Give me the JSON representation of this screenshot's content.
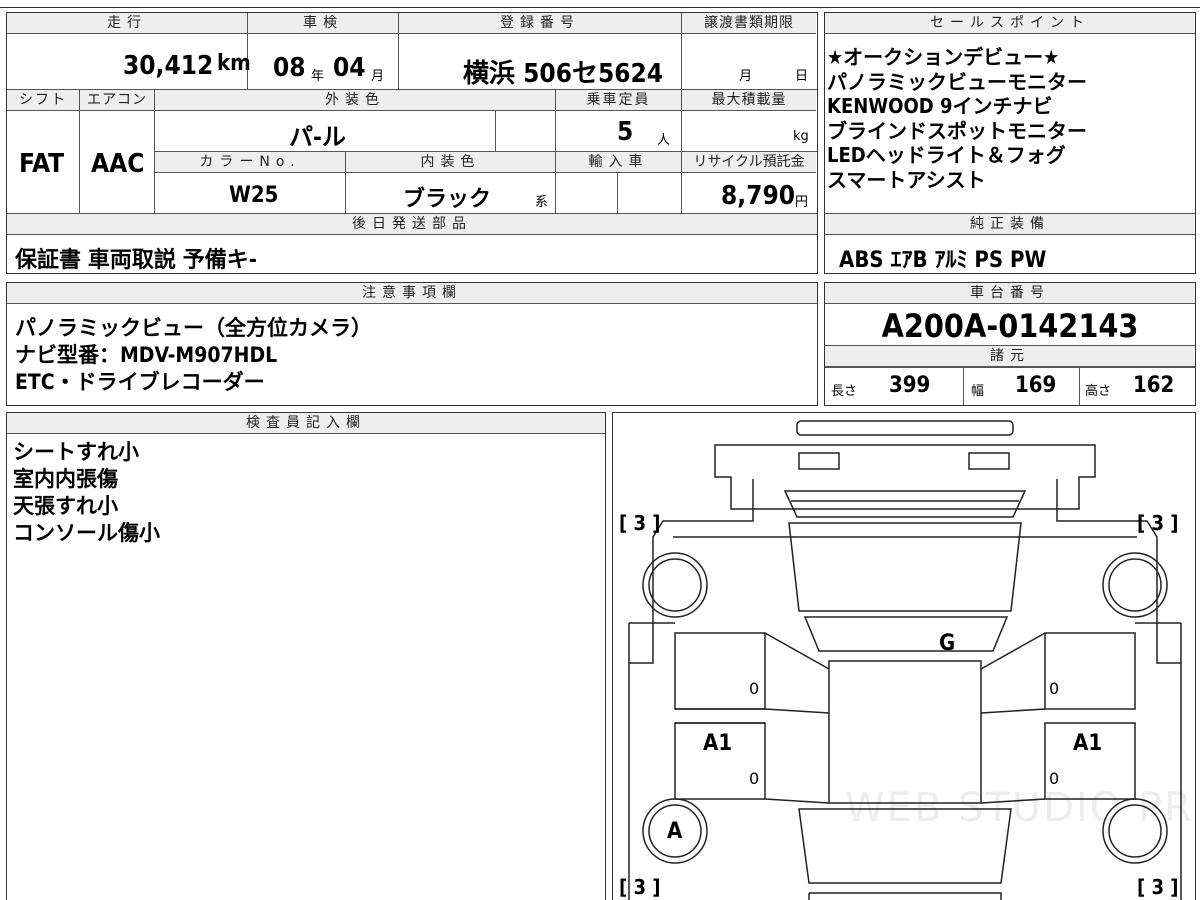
{
  "top_strip": {
    "partial": "…"
  },
  "header_labels": {
    "mileage": "走行",
    "inspection": "車検",
    "registration": "登録番号",
    "transfer_deadline": "譲渡書類期限",
    "shift": "シフト",
    "aircon": "エアコン",
    "exterior_color": "外装色",
    "capacity": "乗車定員",
    "max_load": "最大積載量",
    "color_no": "カラーNo.",
    "interior_color": "内装色",
    "import": "輸入車",
    "recycle": "リサイクル預託金",
    "later_parts": "後日発送部品",
    "sales_points": "セールスポイント",
    "genuine_equipment": "純正装備",
    "notes": "注意事項欄",
    "chassis_no": "車台番号",
    "specs": "諸元",
    "inspector": "検査員記入欄"
  },
  "vehicle": {
    "mileage_value": "30,412",
    "mileage_unit": "km",
    "inspection_year": "08",
    "inspection_year_unit": "年",
    "inspection_month": "04",
    "inspection_month_unit": "月",
    "registration": "横浜 506セ5624",
    "transfer_month": "月",
    "transfer_day": "日",
    "shift": "FAT",
    "aircon": "AAC",
    "exterior_color": "パ-ル",
    "capacity": "5",
    "capacity_unit": "人",
    "max_load_unit": "kg",
    "color_no": "W25",
    "interior_color": "ブラック",
    "interior_suffix": "系",
    "recycle_value": "8,790",
    "recycle_unit": "円",
    "later_parts": "保証書 車両取説 予備キ-",
    "chassis_no": "A200A-0142143"
  },
  "sales_points": [
    "★オークションデビュー★",
    "パノラミックビューモニター",
    "KENWOOD 9インチナビ",
    "ブラインドスポットモニター",
    "LEDヘッドライト＆フォグ",
    "スマートアシスト"
  ],
  "genuine_equipment": "ABS ｴｱB ｱﾙﾐ PS PW",
  "notes": [
    "パノラミックビュー（全方位カメラ）",
    "ナビ型番：MDV-M907HDL",
    "ETC・ドライブレコーダー"
  ],
  "specs": {
    "length_label": "長さ",
    "length": "399",
    "width_label": "幅",
    "width": "169",
    "height_label": "高さ",
    "height": "162"
  },
  "inspector_notes": [
    "シートすれ小",
    "室内内張傷",
    "天張すれ小",
    "コンソール傷小"
  ],
  "diagram": {
    "tire_fl": "[ 3 ]",
    "tire_fr": "[ 3 ]",
    "tire_rl": "[ 3 ]",
    "tire_rr": "[ 3 ]",
    "mark_g": "G",
    "mark_a1_left": "A1",
    "mark_a1_right": "A1",
    "mark_a": "A",
    "zero_1": "0",
    "zero_2": "0",
    "zero_3": "0",
    "zero_4": "0",
    "watermark": "WEB STUDIO PRO"
  }
}
